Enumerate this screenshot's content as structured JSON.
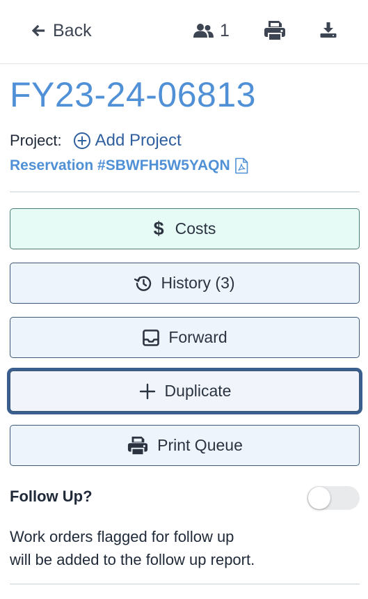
{
  "header": {
    "back_label": "Back",
    "user_count": "1"
  },
  "work_order": {
    "number": "FY23-24-06813",
    "project_label": "Project:",
    "add_project_label": "Add Project",
    "reservation_label": "Reservation #SBWFH5W5YAQN"
  },
  "actions": {
    "costs": "Costs",
    "history": "History (3)",
    "forward": "Forward",
    "duplicate": "Duplicate",
    "print_queue": "Print Queue"
  },
  "follow_up": {
    "label": "Follow Up?",
    "enabled": false,
    "help_line1": "Work orders flagged for follow up",
    "help_line2": "will be added to the follow up report."
  },
  "colors": {
    "accent": "#4f90d6",
    "link": "#2f5f9e",
    "costs_bg": "#e6fbf6",
    "button_bg": "#eef4fc"
  }
}
